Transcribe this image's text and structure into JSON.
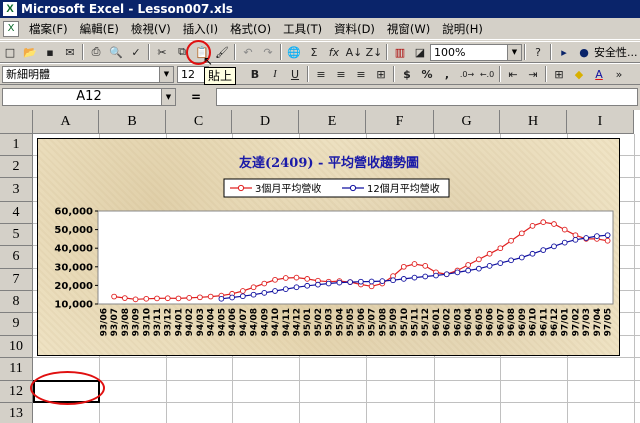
{
  "window": {
    "title": "Microsoft Excel - Lesson007.xls",
    "app_icon": "X"
  },
  "menu": [
    "檔案(F)",
    "編輯(E)",
    "檢視(V)",
    "插入(I)",
    "格式(O)",
    "工具(T)",
    "資料(D)",
    "視窗(W)",
    "說明(H)"
  ],
  "toolbar": {
    "zoom": "100%",
    "font_name": "新細明體",
    "font_size": "12",
    "security_label": "安全性...",
    "tooltip": "貼上",
    "icons": [
      "new-icon",
      "open-icon",
      "save-icon",
      "email-icon",
      "print-icon",
      "print-preview-icon",
      "spelling-icon",
      "cut-icon",
      "copy-icon",
      "paste-icon",
      "format-painter-icon",
      "undo-icon",
      "redo-icon",
      "hyperlink-icon",
      "autosum-icon",
      "function-icon",
      "sort-ascending-icon",
      "sort-descending-icon",
      "chart-wizard-icon",
      "drawing-icon",
      "help-icon"
    ],
    "format_buttons": [
      "B",
      "I",
      "U"
    ],
    "number_buttons": [
      "$",
      "%",
      ","
    ]
  },
  "formula_bar": {
    "name_box": "A12",
    "equals": "=",
    "value": ""
  },
  "grid": {
    "columns": [
      "A",
      "B",
      "C",
      "D",
      "E",
      "F",
      "G",
      "H",
      "I"
    ],
    "rows": [
      "1",
      "2",
      "3",
      "4",
      "5",
      "6",
      "7",
      "8",
      "9",
      "10",
      "11",
      "12",
      "13"
    ],
    "active_cell": "A12"
  },
  "chart_data": {
    "type": "line",
    "title": "友達(2409) - 平均營收趨勢圖",
    "legend_position": "top",
    "ylim": [
      10000,
      60000
    ],
    "yticks": [
      "60,000",
      "50,000",
      "40,000",
      "30,000",
      "20,000",
      "10,000"
    ],
    "x": [
      "93/06",
      "93/07",
      "93/08",
      "93/09",
      "93/10",
      "93/11",
      "93/12",
      "94/01",
      "94/02",
      "94/03",
      "94/04",
      "94/05",
      "94/06",
      "94/07",
      "94/08",
      "94/09",
      "94/10",
      "94/11",
      "94/12",
      "95/01",
      "95/02",
      "95/03",
      "95/04",
      "95/05",
      "95/06",
      "95/07",
      "95/08",
      "95/09",
      "95/10",
      "95/11",
      "95/12",
      "96/01",
      "96/02",
      "96/03",
      "96/04",
      "96/05",
      "96/06",
      "96/07",
      "96/08",
      "96/09",
      "96/10",
      "96/11",
      "96/12",
      "97/01",
      "97/02",
      "97/03",
      "97/04",
      "97/05"
    ],
    "series": [
      {
        "name": "3個月平均營收",
        "color": "#e02020",
        "values": [
          null,
          14000,
          13200,
          12500,
          12800,
          13000,
          13100,
          13000,
          13300,
          13600,
          14000,
          14500,
          15500,
          17000,
          19000,
          21000,
          23000,
          24000,
          24200,
          23500,
          22500,
          22000,
          22300,
          21800,
          20500,
          19500,
          21000,
          25000,
          30000,
          31500,
          30500,
          27000,
          26000,
          28000,
          31000,
          34000,
          37000,
          40000,
          44000,
          48000,
          52000,
          54000,
          53000,
          50000,
          47000,
          45000,
          45000,
          44000
        ]
      },
      {
        "name": "12個月平均營收",
        "color": "#1010a0",
        "values": [
          null,
          null,
          null,
          null,
          null,
          null,
          null,
          null,
          null,
          null,
          null,
          12800,
          13500,
          14200,
          15000,
          16000,
          17000,
          18000,
          19000,
          19800,
          20400,
          21000,
          21500,
          21800,
          22000,
          22100,
          22300,
          22800,
          23500,
          24200,
          24800,
          25300,
          26000,
          27000,
          28000,
          29000,
          30500,
          32000,
          33500,
          35000,
          37000,
          39000,
          41000,
          43000,
          44500,
          45500,
          46500,
          47000
        ]
      }
    ]
  },
  "colors": {
    "title_bar": "#0a246a",
    "chart_title": "#1a1aa8",
    "highlight_ring": "#e01010"
  }
}
